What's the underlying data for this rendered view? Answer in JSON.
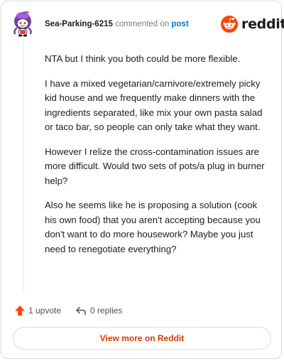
{
  "comment": {
    "username": "Sea-Parking-6215",
    "action": "commented on",
    "post_link": "post",
    "paragraphs": [
      "NTA but I think you both could be more flexible.",
      "I have a mixed vegetarian/carnivore/extremely picky kid house and we frequently make dinners with the ingredients separated, like mix your own pasta salad or taco bar, so people can only take what they want.",
      "However I relize the cross-contamination issues are more difficult. Would two sets of pots/a plug in burner help?",
      "Also he seems like he is proposing a solution (cook his own food) that you aren't accepting because you don't want to do more housework? Maybe you just need to renegotiate everything?"
    ]
  },
  "brand": {
    "name": "reddit",
    "icon": "reddit-logo-icon",
    "color": "#ff4500"
  },
  "footer": {
    "upvote_label": "1 upvote",
    "upvote_icon": "upvote-arrow-icon",
    "upvote_color": "#ff4500",
    "replies_label": "0 replies",
    "reply_icon": "reply-arrow-icon"
  },
  "view_more_label": "View more on Reddit",
  "colors": {
    "link": "#0079d3",
    "view_more": "#d93a00"
  }
}
